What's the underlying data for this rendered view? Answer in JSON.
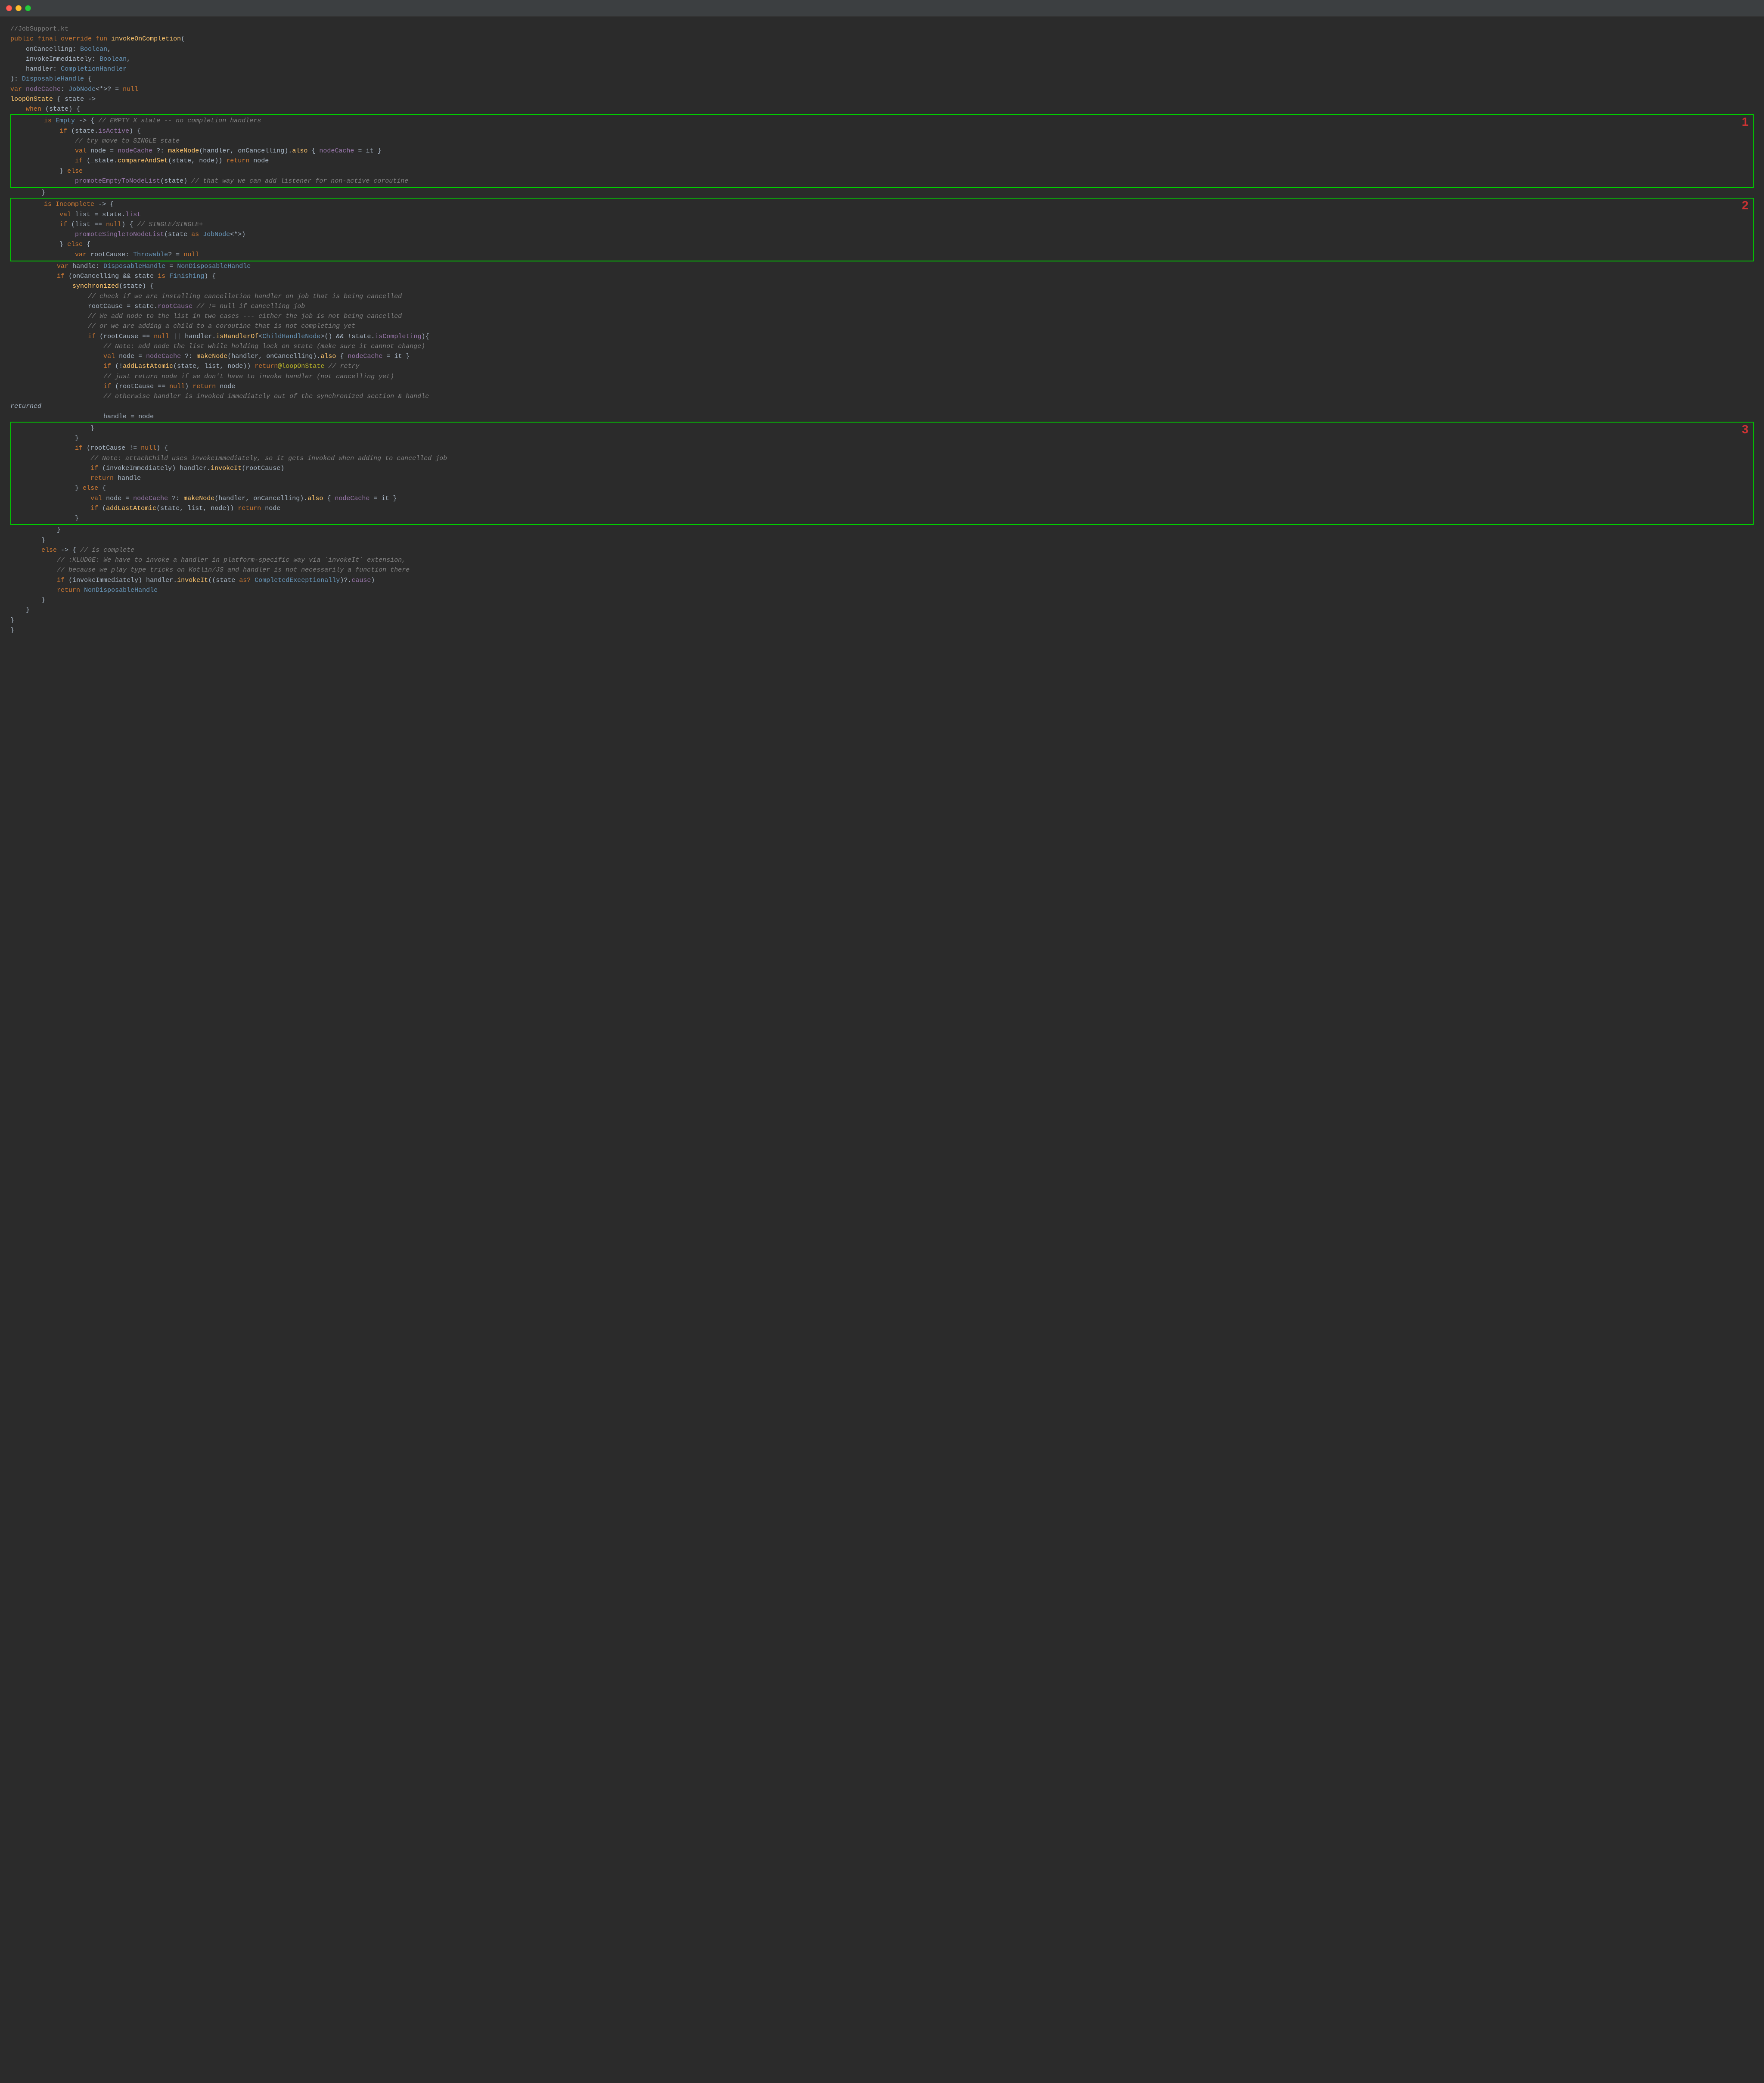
{
  "window": {
    "title": "JobSupport.kt",
    "traffic_lights": [
      "red",
      "yellow",
      "green"
    ]
  },
  "code": {
    "filename": "//JobSupport.kt",
    "boxes": {
      "1": {
        "label": "1"
      },
      "2": {
        "label": "2"
      },
      "3": {
        "label": "3"
      }
    }
  }
}
